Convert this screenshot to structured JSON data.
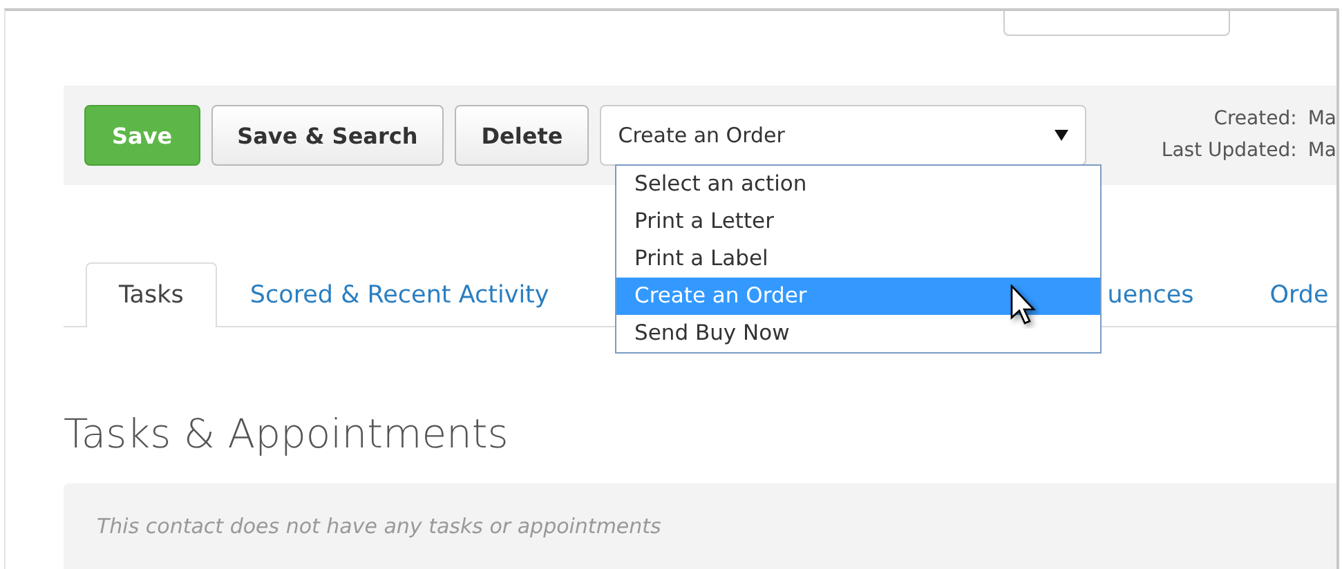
{
  "toolbar": {
    "buttons": [
      {
        "label": "Save",
        "kind": "primary"
      },
      {
        "label": "Save & Search",
        "kind": "default"
      },
      {
        "label": "Delete",
        "kind": "default"
      }
    ],
    "action_select": {
      "value": "Create an Order",
      "expanded": true,
      "options": [
        {
          "label": "Select an action",
          "selected": false
        },
        {
          "label": "Print a Letter",
          "selected": false
        },
        {
          "label": "Print a Label",
          "selected": false
        },
        {
          "label": "Create an Order",
          "selected": true
        },
        {
          "label": "Send Buy Now",
          "selected": false
        }
      ]
    },
    "meta": [
      {
        "label": "Created:",
        "value": "Ma"
      },
      {
        "label": "Last Updated:",
        "value": "Ma"
      }
    ]
  },
  "tabs": [
    {
      "label": "Tasks",
      "selected": true
    },
    {
      "label": "Scored & Recent Activity",
      "selected": false
    },
    {
      "label": "uences",
      "selected": false
    },
    {
      "label": "Orde",
      "selected": false
    }
  ],
  "section": {
    "title": "Tasks & Appointments",
    "empty_message": "This contact does not have any tasks or appointments"
  }
}
